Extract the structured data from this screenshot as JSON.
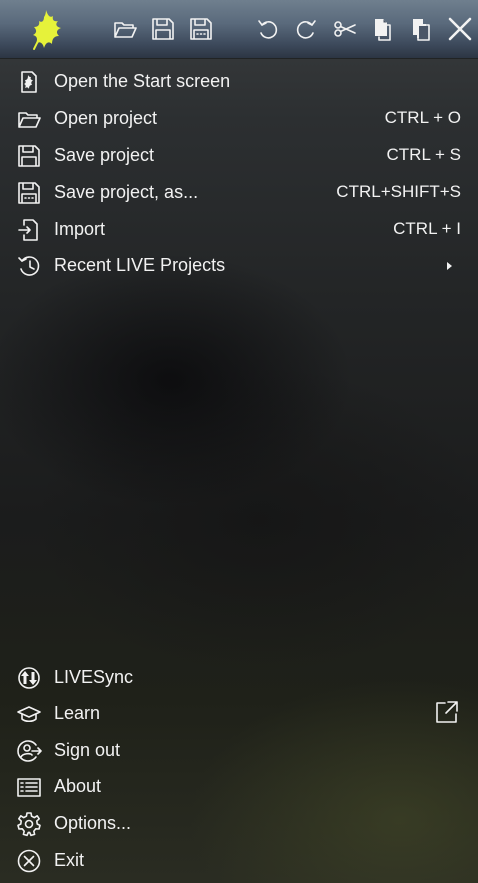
{
  "toolbar": {
    "logo": "firefly-logo",
    "buttons": [
      "open-folder-icon",
      "save-icon",
      "save-as-icon",
      "undo-icon",
      "redo-icon",
      "cut-icon",
      "copy-icon",
      "paste-icon",
      "close-icon"
    ]
  },
  "file_menu": [
    {
      "label": "Open the Start screen",
      "shortcut": "",
      "icon": "start-screen-icon"
    },
    {
      "label": "Open project",
      "shortcut": "CTRL + O",
      "icon": "open-folder-icon"
    },
    {
      "label": "Save project",
      "shortcut": "CTRL + S",
      "icon": "save-icon"
    },
    {
      "label": "Save project, as...",
      "shortcut": "CTRL+SHIFT+S",
      "icon": "save-as-icon"
    },
    {
      "label": "Import",
      "shortcut": "CTRL + I",
      "icon": "import-icon"
    },
    {
      "label": "Recent LIVE Projects",
      "shortcut": "",
      "icon": "history-icon"
    }
  ],
  "bottom_menu": [
    {
      "label": "LIVESync",
      "icon": "sync-icon"
    },
    {
      "label": "Learn",
      "icon": "graduation-cap-icon"
    },
    {
      "label": "Sign out",
      "icon": "sign-out-icon"
    },
    {
      "label": "About",
      "icon": "about-list-icon"
    },
    {
      "label": "Options...",
      "icon": "gear-icon"
    },
    {
      "label": "Exit",
      "icon": "exit-circle-icon"
    }
  ],
  "colors": {
    "logo_yellow": "#e6f23a",
    "text": "#f2f2f2",
    "toolbar_top": "#6f7f8e",
    "toolbar_bottom": "#2c3543"
  }
}
